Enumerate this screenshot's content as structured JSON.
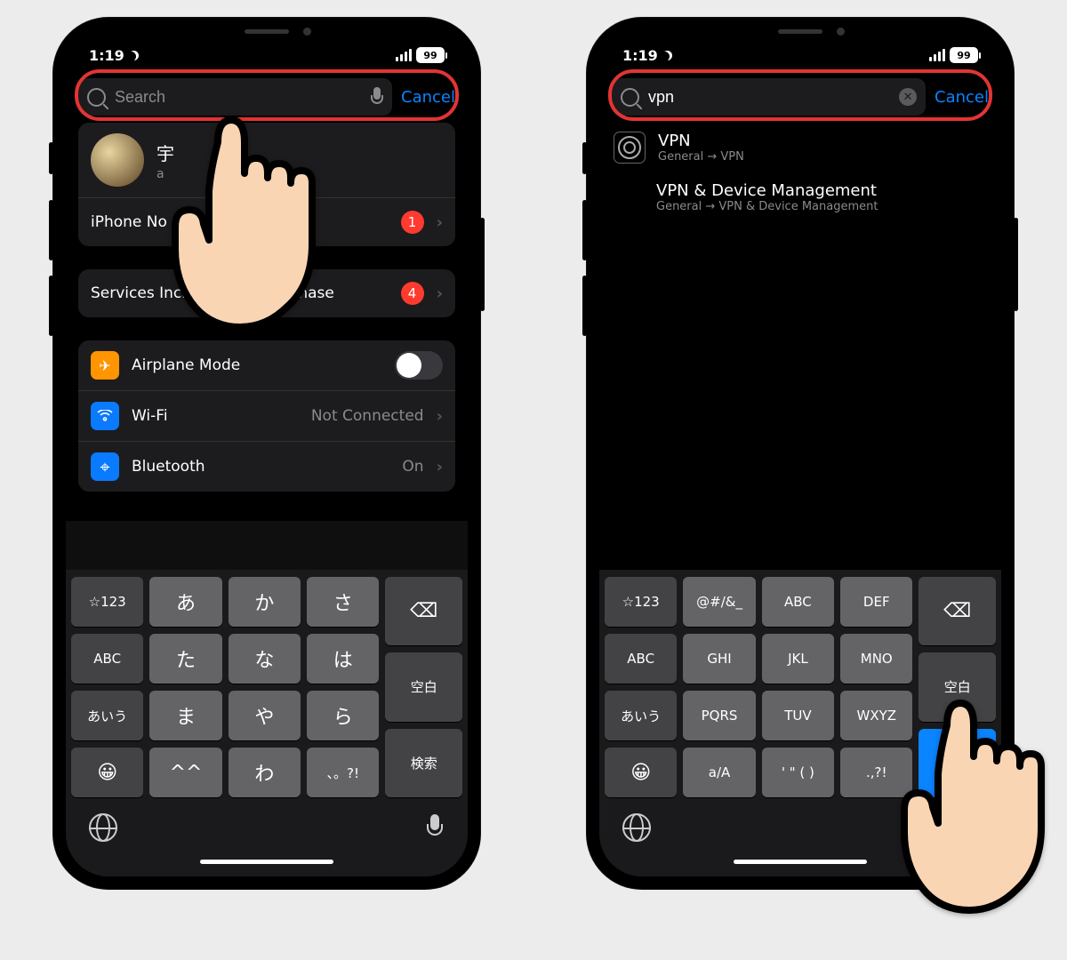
{
  "left": {
    "status": {
      "time": "1:19",
      "battery": "99"
    },
    "search": {
      "placeholder": "Search",
      "value": "",
      "cancel": "Cancel"
    },
    "profile": {
      "name": "宇",
      "sub": "a"
    },
    "rows": {
      "backup": {
        "label": "iPhone No",
        "badge": "1"
      },
      "services": {
        "label": "Services Included with Purchase",
        "badge": "4"
      },
      "airplane": {
        "label": "Airplane Mode"
      },
      "wifi": {
        "label": "Wi-Fi",
        "value": "Not Connected"
      },
      "bluetooth": {
        "label": "Bluetooth",
        "value": "On"
      }
    },
    "keyboard": {
      "r1": [
        "☆123",
        "あ",
        "か",
        "さ"
      ],
      "r2": [
        "ABC",
        "た",
        "な",
        "は",
        "空白"
      ],
      "r3": [
        "あいう",
        "ま",
        "や",
        "ら"
      ],
      "r4": [
        "^^",
        "わ",
        "、。?!"
      ],
      "search": "検索"
    }
  },
  "right": {
    "status": {
      "time": "1:19",
      "battery": "99"
    },
    "search": {
      "value": "vpn",
      "cancel": "Cancel"
    },
    "results": [
      {
        "title": "VPN",
        "path": "General → VPN"
      },
      {
        "title": "VPN & Device Management",
        "path": "General → VPN & Device Management"
      }
    ],
    "keyboard": {
      "r1": [
        "☆123",
        "@#/&_",
        "ABC",
        "DEF"
      ],
      "r2": [
        "ABC",
        "GHI",
        "JKL",
        "MNO",
        "空白"
      ],
      "r3": [
        "あいう",
        "PQRS",
        "TUV",
        "WXYZ"
      ],
      "r4": [
        "a/A",
        "' \" ( )",
        ".,?!"
      ]
    }
  }
}
